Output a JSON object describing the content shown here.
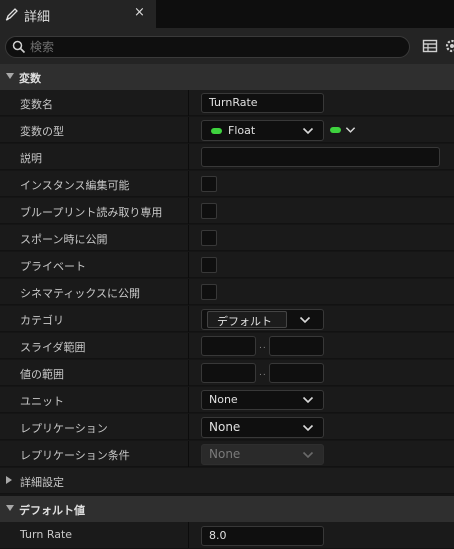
{
  "tab": {
    "title": "詳細",
    "close": "×",
    "icon": "pencil-icon"
  },
  "search": {
    "placeholder": "検索",
    "value": ""
  },
  "sections": {
    "variables": "変数",
    "defaults": "デフォルト値"
  },
  "rows": {
    "var_name": {
      "label": "変数名",
      "value": "TurnRate"
    },
    "var_type": {
      "label": "変数の型",
      "value": "Float",
      "type_color": "#3ed23e"
    },
    "description": {
      "label": "説明",
      "value": ""
    },
    "instance_editable": {
      "label": "インスタンス編集可能",
      "checked": false
    },
    "bp_read_only": {
      "label": "ブループリント読み取り専用",
      "checked": false
    },
    "expose_on_spawn": {
      "label": "スポーン時に公開",
      "checked": false
    },
    "private": {
      "label": "プライベート",
      "checked": false
    },
    "expose_cinematics": {
      "label": "シネマティックスに公開",
      "checked": false
    },
    "category": {
      "label": "カテゴリ",
      "value": "デフォルト"
    },
    "slider_range": {
      "label": "スライダ範囲",
      "sep": "..",
      "min": "",
      "max": ""
    },
    "value_range": {
      "label": "値の範囲",
      "sep": "..",
      "min": "",
      "max": ""
    },
    "unit": {
      "label": "ユニット",
      "value": "None"
    },
    "replication": {
      "label": "レプリケーション",
      "value": "None"
    },
    "replication_condition": {
      "label": "レプリケーション条件",
      "value": "None"
    },
    "advanced": {
      "label": "詳細設定"
    },
    "turn_rate": {
      "label": "Turn Rate",
      "value": "8.0"
    }
  }
}
